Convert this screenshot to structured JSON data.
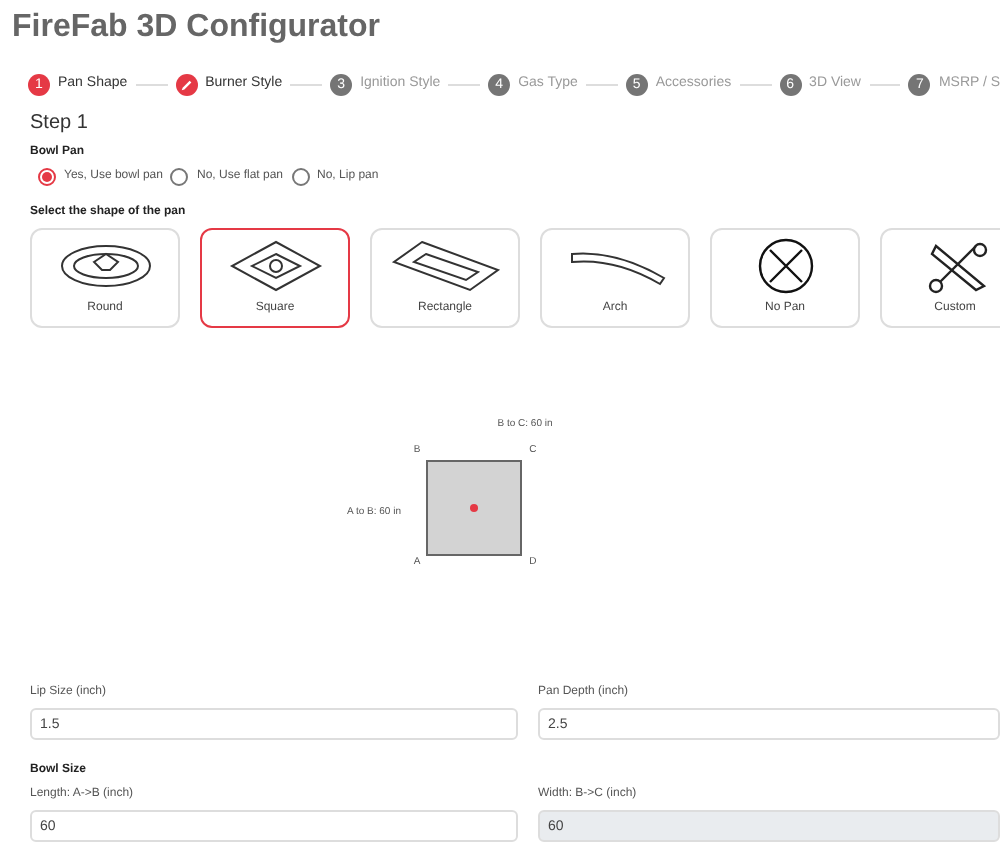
{
  "title": "FireFab 3D Configurator",
  "steps": [
    {
      "number": "1",
      "label": "Pan Shape",
      "active": true
    },
    {
      "label": "Burner Style",
      "active": true
    },
    {
      "number": "3",
      "label": "Ignition Style",
      "active": false
    },
    {
      "number": "4",
      "label": "Gas Type",
      "active": false
    },
    {
      "number": "5",
      "label": "Accessories",
      "active": false
    },
    {
      "number": "6",
      "label": "3D View",
      "active": false
    },
    {
      "number": "7",
      "label": "MSRP / S",
      "active": false
    }
  ],
  "step_heading": "Step 1",
  "bowl_pan": {
    "label": "Bowl Pan",
    "options": [
      {
        "label": "Yes, Use bowl pan",
        "selected": true
      },
      {
        "label": "No, Use flat pan",
        "selected": false
      },
      {
        "label": "No, Lip pan",
        "selected": false
      }
    ]
  },
  "shape_prompt": "Select the shape of the pan",
  "shapes": [
    {
      "label": "Round",
      "kind": "round",
      "selected": false
    },
    {
      "label": "Square",
      "kind": "square",
      "selected": true
    },
    {
      "label": "Rectangle",
      "kind": "rectangle",
      "selected": false
    },
    {
      "label": "Arch",
      "kind": "arch",
      "selected": false
    },
    {
      "label": "No Pan",
      "kind": "none",
      "selected": false
    },
    {
      "label": "Custom",
      "kind": "custom",
      "selected": false
    }
  ],
  "diagram": {
    "top_label": "B to C: 60 in",
    "side_label": "A to B: 60 in",
    "corners": [
      "B",
      "C",
      "A",
      "D"
    ]
  },
  "fields": [
    {
      "label": "Lip Size (inch)",
      "value": "1.5",
      "disabled": false
    },
    {
      "label": "Pan Depth (inch)",
      "value": "2.5",
      "disabled": false
    }
  ],
  "bowl_size": {
    "label": "Bowl Size",
    "fields": [
      {
        "label": "Length: A->B (inch)",
        "value": "60",
        "disabled": false
      },
      {
        "label": "Width: B->C (inch)",
        "value": "60",
        "disabled": true
      }
    ]
  }
}
